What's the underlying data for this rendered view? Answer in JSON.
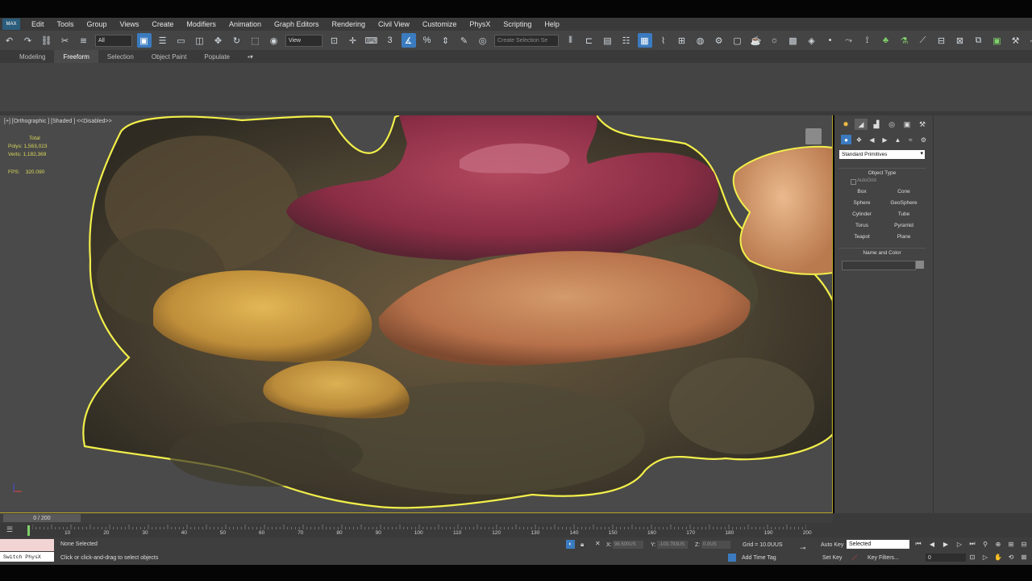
{
  "app_icon": "MAX",
  "menu": [
    "Edit",
    "Tools",
    "Group",
    "Views",
    "Create",
    "Modifiers",
    "Animation",
    "Graph Editors",
    "Rendering",
    "Civil View",
    "Customize",
    "PhysX",
    "Scripting",
    "Help"
  ],
  "toolbar": {
    "filter_value": "All",
    "refcoord_value": "View",
    "selection_set_placeholder": "Create Selection Se"
  },
  "ribbon_tabs": [
    "Modeling",
    "Freeform",
    "Selection",
    "Object Paint",
    "Populate"
  ],
  "viewport": {
    "label": "[+] [Orthographic ] [Shaded ]  <<Disabled>>",
    "stats": {
      "total_label": "Total",
      "polys_label": "Polys:",
      "polys": "1,563,023",
      "verts_label": "Verts:",
      "verts": "1,182,369",
      "fps_label": "FPS:",
      "fps": "320.090"
    }
  },
  "command_panel": {
    "category": "Standard Primitives",
    "object_type_title": "Object Type",
    "autogrid": "AutoGrid",
    "objects": [
      "Box",
      "Cone",
      "Sphere",
      "GeoSphere",
      "Cylinder",
      "Tube",
      "Torus",
      "Pyramid",
      "Teapot",
      "Plane"
    ],
    "name_color_title": "Name and Color"
  },
  "timeline": {
    "slider": "0 / 200",
    "ticks": [
      "10",
      "20",
      "30",
      "40",
      "50",
      "60",
      "70",
      "80",
      "90",
      "100",
      "110",
      "120",
      "130",
      "140",
      "150",
      "160",
      "170",
      "180",
      "190",
      "200"
    ]
  },
  "status": {
    "switch_physx": "Switch PhysX",
    "selection": "None Selected",
    "prompt": "Click or click-and-drag to select objects",
    "x_label": "X:",
    "x_value": "98.500US",
    "y_label": "Y:",
    "y_value": "-103.793US",
    "z_label": "Z:",
    "z_value": "0.0US",
    "grid": "Grid = 10.0UUS",
    "add_time_tag": "Add Time Tag",
    "auto_key": "Auto Key",
    "set_key": "Set Key",
    "key_mode": "Selected",
    "key_filters": "Key Filters...",
    "frame": "0"
  },
  "colors": {
    "selection_outline": "#f2ef4a",
    "active_blue": "#3b7bbf",
    "stats_yellow": "#d9d75a"
  }
}
